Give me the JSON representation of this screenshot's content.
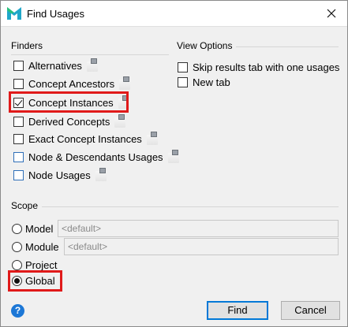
{
  "window": {
    "title": "Find Usages"
  },
  "finders": {
    "label": "Finders",
    "items": [
      {
        "label": "Alternatives",
        "mnemonic": "A",
        "rest": "lternatives",
        "checked": false,
        "blue": false
      },
      {
        "label": "Concept Ancestors",
        "checked": false,
        "blue": false
      },
      {
        "label": "Concept Instances",
        "checked": true,
        "blue": false
      },
      {
        "label": "Derived Concepts",
        "checked": false,
        "blue": false
      },
      {
        "label": "Exact Concept Instances",
        "checked": false,
        "blue": false
      },
      {
        "label": "Node & Descendants Usages",
        "checked": false,
        "blue": true
      },
      {
        "label": "Node Usages",
        "checked": false,
        "blue": true
      }
    ]
  },
  "view_options": {
    "label": "View Options",
    "items": [
      {
        "label": "Skip results tab with one usages",
        "checked": false
      },
      {
        "label": "New tab",
        "checked": false
      }
    ]
  },
  "scope": {
    "label": "Scope",
    "options": [
      {
        "label": "Model",
        "input": "<default>",
        "selected": false
      },
      {
        "label": "Module",
        "input": "<default>",
        "selected": false
      },
      {
        "label": "Project",
        "selected": false
      },
      {
        "label": "Global",
        "selected": true
      }
    ]
  },
  "buttons": {
    "help": "?",
    "find": "Find",
    "cancel": "Cancel"
  },
  "colors": {
    "highlight": "#e01a1a",
    "accent": "#0078d7",
    "help": "#1c77d6"
  }
}
